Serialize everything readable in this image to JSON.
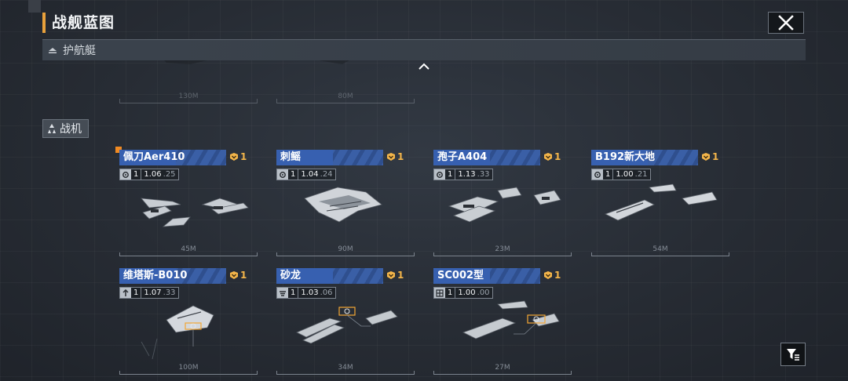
{
  "header": {
    "title": "战舰蓝图"
  },
  "section_escort": {
    "label": "护航艇"
  },
  "escort_faded": [
    {
      "length": "130M"
    },
    {
      "length": "80M"
    }
  ],
  "section_fighter": {
    "label": "战机"
  },
  "cards": [
    {
      "name": "佩刀Aer410",
      "count": "1",
      "level": "1",
      "version": "1.06",
      "sub": ".25",
      "length": "45M",
      "stat_icon": "gear-icon"
    },
    {
      "name": "刺鳐",
      "count": "1",
      "level": "1",
      "version": "1.04",
      "sub": ".24",
      "length": "90M",
      "stat_icon": "gear-icon"
    },
    {
      "name": "孢子A404",
      "count": "1",
      "level": "1",
      "version": "1.13",
      "sub": ".33",
      "length": "23M",
      "stat_icon": "gear-icon"
    },
    {
      "name": "B192新大地",
      "count": "1",
      "level": "1",
      "version": "1.00",
      "sub": ".21",
      "length": "54M",
      "stat_icon": "gear-icon"
    },
    {
      "name": "维塔斯-B010",
      "count": "1",
      "level": "1",
      "version": "1.07",
      "sub": ".33",
      "length": "100M",
      "stat_icon": "arrow-icon"
    },
    {
      "name": "砂龙",
      "count": "1",
      "level": "1",
      "version": "1.03",
      "sub": ".06",
      "length": "34M",
      "stat_icon": "wing-icon"
    },
    {
      "name": "SC002型",
      "count": "1",
      "level": "1",
      "version": "1.00",
      "sub": ".00",
      "length": "27M",
      "stat_icon": "grid-icon"
    }
  ],
  "colors": {
    "accent": "#e9a13b",
    "name_bar": "#3760b0",
    "count": "#f3b54a",
    "selection": "#f08a22"
  }
}
